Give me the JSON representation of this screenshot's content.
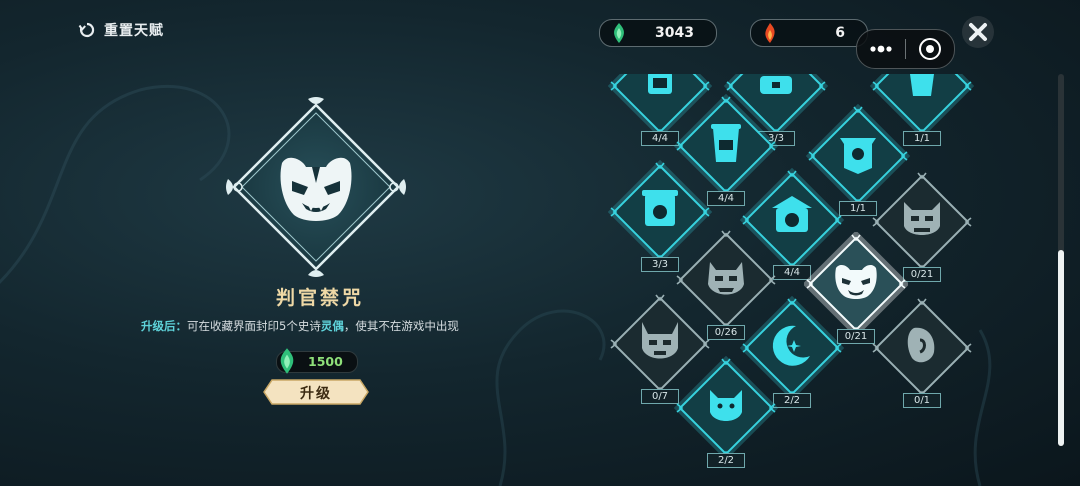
{
  "header": {
    "reset_label": "重置天赋",
    "currencies": [
      {
        "name": "gem",
        "value": "3043",
        "color": "#3fd48a"
      },
      {
        "name": "fire",
        "value": "6",
        "color": "#f05a2a"
      }
    ]
  },
  "detail": {
    "title": "判官禁咒",
    "desc_prefix": "升级后：",
    "desc_main": "可在收藏界面封印5个史诗",
    "desc_highlight": "灵偶",
    "desc_suffix": "，使其不在游戏中出现",
    "cost": "1500",
    "upgrade_label": "升级"
  },
  "nodes": [
    {
      "id": "n-top-a",
      "count": "4/4",
      "icon": "tome-icon",
      "active": true
    },
    {
      "id": "n-top-b",
      "count": "3/3",
      "icon": "chest-icon",
      "active": true
    },
    {
      "id": "n-top-c",
      "count": "1/1",
      "icon": "cup-icon",
      "active": true
    },
    {
      "id": "n-drink",
      "count": "4/4",
      "icon": "drink-cup-icon",
      "active": true
    },
    {
      "id": "n-banner",
      "count": "1/1",
      "icon": "banner-icon",
      "active": true
    },
    {
      "id": "n-signboard",
      "count": "3/3",
      "icon": "signboard-icon",
      "active": true
    },
    {
      "id": "n-shrine",
      "count": "4/4",
      "icon": "shrine-icon",
      "active": true
    },
    {
      "id": "n-demon",
      "count": "0/21",
      "icon": "demon-mask-icon",
      "active": false
    },
    {
      "id": "n-oni",
      "count": "0/26",
      "icon": "oni-mask-icon",
      "active": false
    },
    {
      "id": "n-judge",
      "count": "0/21",
      "icon": "judge-mask-icon",
      "active": false,
      "selected": true
    },
    {
      "id": "n-horned",
      "count": "0/7",
      "icon": "horned-mask-icon",
      "active": false
    },
    {
      "id": "n-moon",
      "count": "2/2",
      "icon": "moon-star-icon",
      "active": true
    },
    {
      "id": "n-stone",
      "count": "0/1",
      "icon": "stone-charm-icon",
      "active": false
    },
    {
      "id": "n-cat",
      "count": "2/2",
      "icon": "cat-face-icon",
      "active": true
    }
  ]
}
